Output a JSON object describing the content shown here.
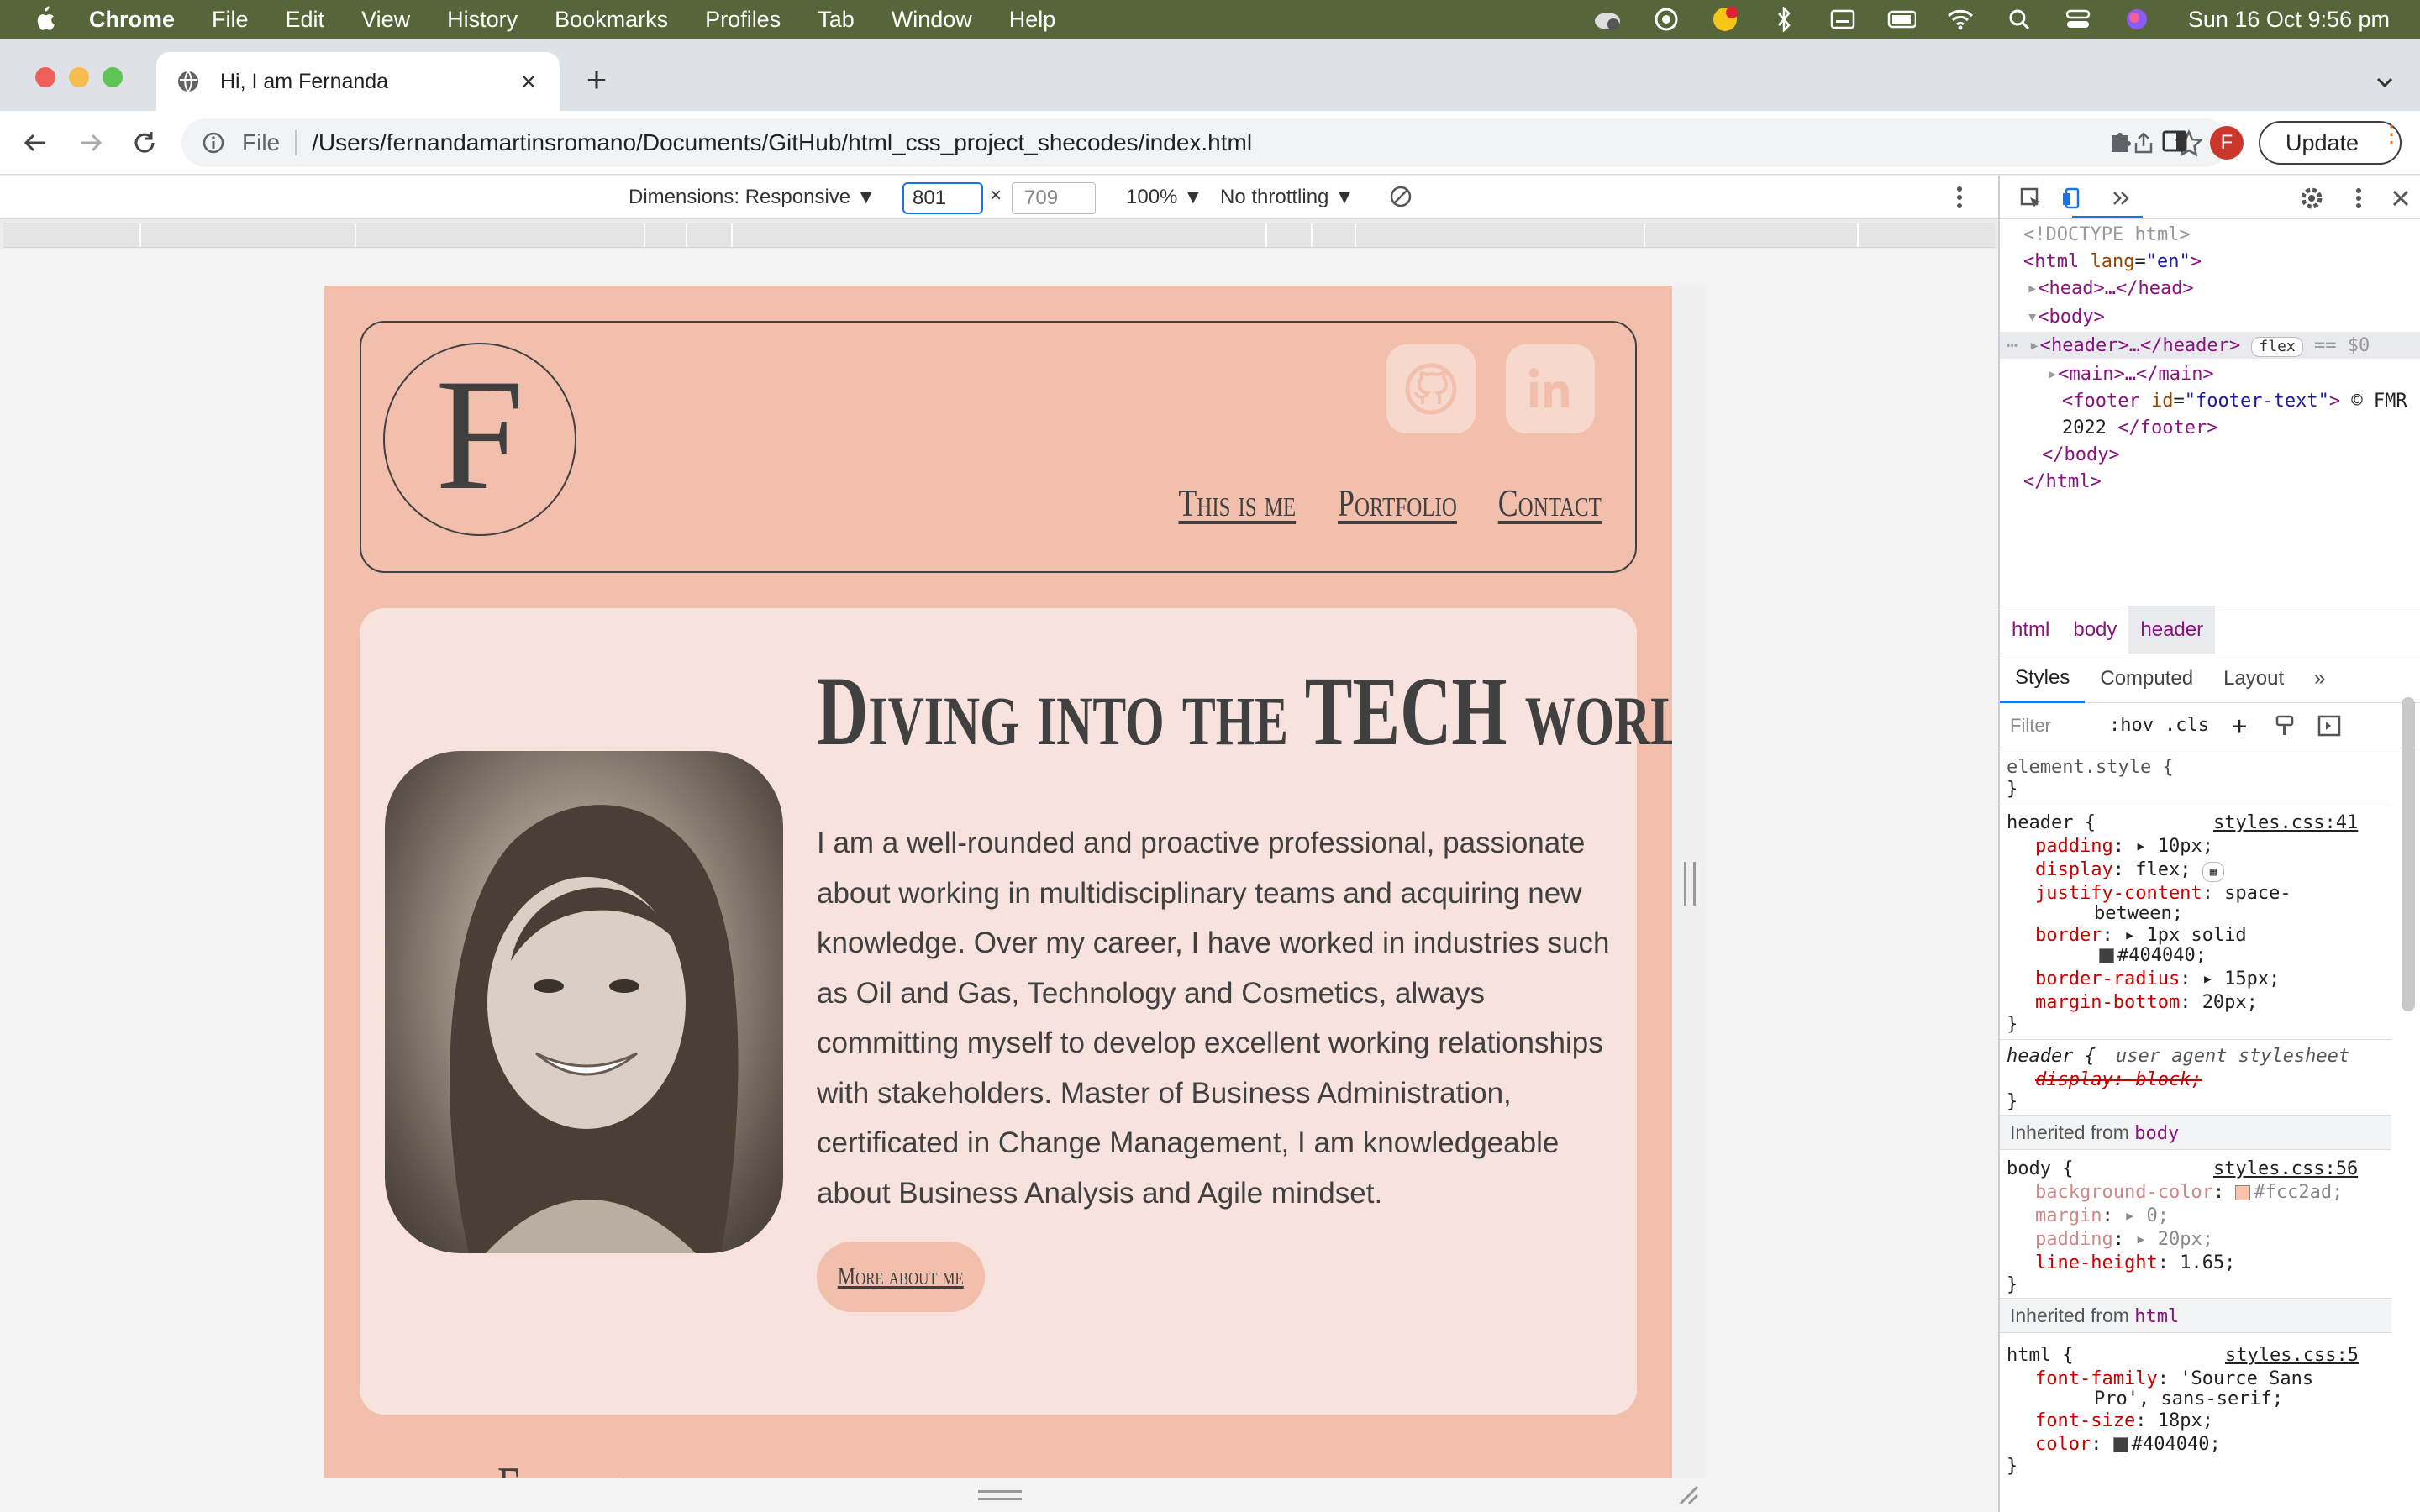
{
  "menubar": {
    "app": "Chrome",
    "items": [
      "File",
      "Edit",
      "View",
      "History",
      "Bookmarks",
      "Profiles",
      "Tab",
      "Window",
      "Help"
    ],
    "clock": "Sun 16 Oct  9:56 pm"
  },
  "tab": {
    "title": "Hi, I am Fernanda"
  },
  "omnibox": {
    "scheme": "File",
    "url": "/Users/fernandamartinsromano/Documents/GitHub/html_css_project_shecodes/index.html"
  },
  "toolbar": {
    "profile_initial": "F",
    "update_label": "Update"
  },
  "device_toolbar": {
    "dimensions": "Dimensions: Responsive ▼",
    "width": "801",
    "times": "×",
    "height": "709",
    "zoom": "100% ▼",
    "throttling": "No throttling ▼"
  },
  "site": {
    "logo_letter": "F",
    "nav": [
      "This is me",
      "Portfolio",
      "Contact"
    ],
    "hero_title": "Diving into the TECH world.",
    "hero_text": "I am a well-rounded and proactive professional, passionate about working in multidisciplinary teams and acquiring new knowledge. Over my career, I have worked in industries such as Oil and Gas, Technology and Cosmetics, always committing myself to develop excellent working relationships with stakeholders. Master of Business Administration, certificated in Change Management, I am knowledgeable about Business Analysis and Agile mindset.",
    "hero_button": "More about me",
    "next_heading": "Expertise"
  },
  "devtools": {
    "dom": {
      "doctype": "<!DOCTYPE html>",
      "html_open_tag": "<html",
      "html_attr": "lang",
      "html_attr_val": "\"en\"",
      "head": "<head>…</head>",
      "body_open": "<body>",
      "header": "<header>…</header>",
      "header_badge": "flex",
      "header_eq": "== $0",
      "main": "<main>…</main>",
      "footer_open": "<footer",
      "footer_attr": "id",
      "footer_attr_val": "\"footer-text\"",
      "footer_text": "© FMR",
      "footer_text2": "2022",
      "footer_close": "</footer>",
      "body_close": "</body>",
      "html_close": "</html>"
    },
    "breadcrumbs": [
      "html",
      "body",
      "header"
    ],
    "tabs": [
      "Styles",
      "Computed",
      "Layout"
    ],
    "filter_placeholder": "Filter",
    "hov": ":hov",
    "cls": ".cls",
    "styles": {
      "element_style": "element.style {",
      "close": "}",
      "header_selector": "header {",
      "header_source": "styles.css:41",
      "header_props": [
        {
          "p": "padding",
          "v": "▸ 10px;"
        },
        {
          "p": "display",
          "v": "flex;"
        },
        {
          "p": "justify-content",
          "v": "space-"
        },
        {
          "p": "",
          "v": "between;"
        },
        {
          "p": "border",
          "v": "▸ 1px solid"
        },
        {
          "p": "",
          "v": "#404040;"
        },
        {
          "p": "border-radius",
          "v": "▸ 15px;"
        },
        {
          "p": "margin-bottom",
          "v": "20px;"
        }
      ],
      "ua_selector": "header {",
      "ua_source": "user agent stylesheet",
      "ua_prop": "display: block;",
      "inherited_body": "Inherited from",
      "inherited_body_tag": "body",
      "body_selector": "body {",
      "body_source": "styles.css:56",
      "body_props": [
        {
          "p": "background-color",
          "v": "#fcc2ad;"
        },
        {
          "p": "margin",
          "v": "▸ 0;"
        },
        {
          "p": "padding",
          "v": "▸ 20px;"
        },
        {
          "p": "line-height",
          "v": "1.65;"
        }
      ],
      "inherited_html": "Inherited from",
      "inherited_html_tag": "html",
      "html_selector": "html {",
      "html_source": "styles.css:5",
      "html_props": [
        {
          "p": "font-family",
          "v": "'Source Sans"
        },
        {
          "p": "",
          "v": "Pro', sans-serif;"
        },
        {
          "p": "font-size",
          "v": "18px;"
        },
        {
          "p": "color",
          "v": "#404040;"
        }
      ]
    }
  },
  "colors": {
    "page_bg": "#f2bfad",
    "hero_bg": "#f7e2dd",
    "text": "#404040",
    "menubar": "#56663a"
  }
}
